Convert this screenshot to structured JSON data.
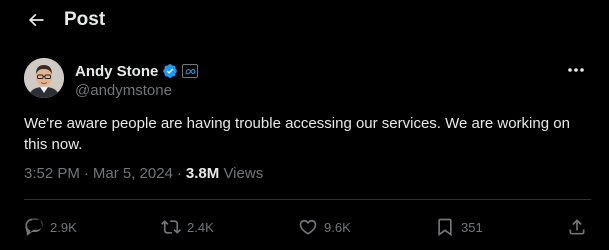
{
  "header": {
    "title": "Post",
    "back_icon": "arrow-left-icon"
  },
  "author": {
    "display_name": "Andy Stone",
    "handle": "@andymstone",
    "verified_icon": "verified-badge-icon",
    "affiliate_icon": "meta-logo-icon",
    "verified_color": "#1d9bf0"
  },
  "post": {
    "text": "We're aware people are having trouble accessing our services. We are working on this now.",
    "time": "3:52 PM",
    "separator": "·",
    "date": "Mar 5, 2024",
    "views_count": "3.8M",
    "views_label": "Views"
  },
  "actions": {
    "reply": {
      "icon": "reply-icon",
      "count": "2.9K"
    },
    "repost": {
      "icon": "repost-icon",
      "count": "2.4K"
    },
    "like": {
      "icon": "heart-icon",
      "count": "9.6K"
    },
    "bookmark": {
      "icon": "bookmark-icon",
      "count": "351"
    },
    "share": {
      "icon": "share-icon"
    }
  },
  "colors": {
    "background": "#000000",
    "text": "#e7e9ea",
    "muted": "#71767b",
    "divider": "#2f3336"
  }
}
